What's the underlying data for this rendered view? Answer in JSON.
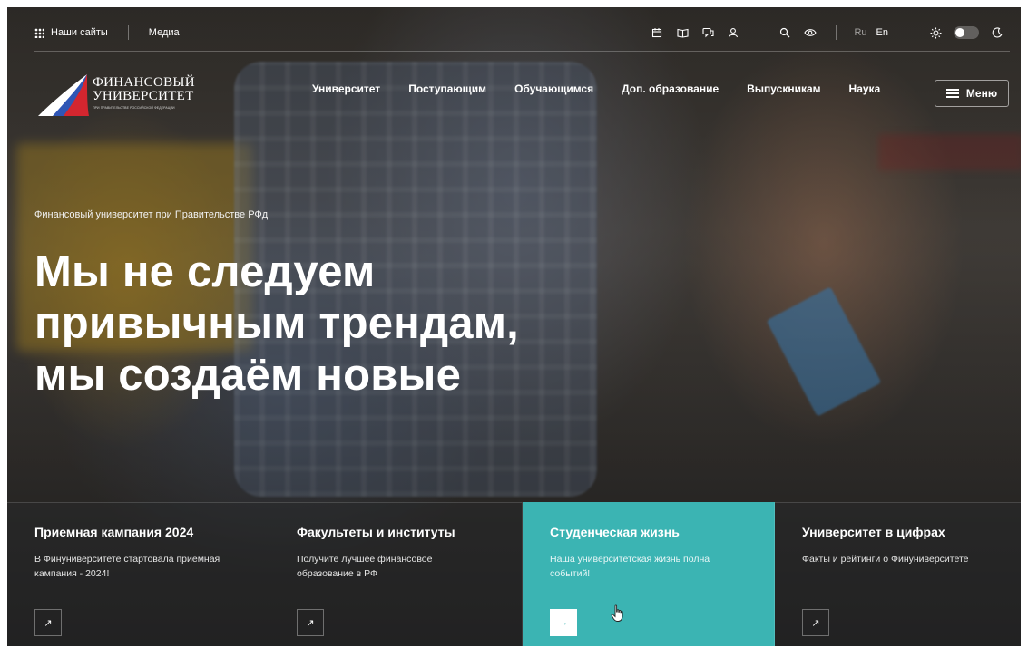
{
  "colors": {
    "accent": "#3bb4b3",
    "text": "#ffffff"
  },
  "topbar": {
    "sites_label": "Наши сайты",
    "media_label": "Медиа",
    "lang_ru": "Ru",
    "lang_en": "En",
    "icons": [
      "calendar-icon",
      "book-icon",
      "chat-icon",
      "user-icon",
      "search-icon",
      "eye-icon",
      "sun-icon",
      "theme-toggle",
      "moon-icon"
    ]
  },
  "logo": {
    "line1": "ФИНАНСОВЫЙ",
    "line2": "УНИВЕРСИТЕТ",
    "line3": "ПРИ ПРАВИТЕЛЬСТВЕ РОССИЙСКОЙ ФЕДЕРАЦИИ"
  },
  "nav": {
    "items": [
      {
        "label": "Университет"
      },
      {
        "label": "Поступающим"
      },
      {
        "label": "Обучающимся"
      },
      {
        "label": "Доп. образование"
      },
      {
        "label": "Выпускникам"
      },
      {
        "label": "Наука"
      }
    ],
    "menu_label": "Меню"
  },
  "hero": {
    "subtitle": "Финансовый университет при Правительстве РФд",
    "title_lines": [
      "Мы не следуем",
      "привычным трендам,",
      "мы создаём новые"
    ]
  },
  "cards": [
    {
      "title": "Приемная кампания 2024",
      "text": "В Финуниверситете стартовала приёмная кампания - 2024!",
      "arrow": "↗",
      "active": false
    },
    {
      "title": "Факультеты и институты",
      "text": "Получите лучшее финансовое образование в РФ",
      "arrow": "↗",
      "active": false
    },
    {
      "title": "Студенческая жизнь",
      "text": "Наша университетская жизнь полна событий!",
      "arrow": "→",
      "active": true
    },
    {
      "title": "Университет в цифрах",
      "text": "Факты и рейтинги о Финуниверситете",
      "arrow": "↗",
      "active": false
    }
  ]
}
